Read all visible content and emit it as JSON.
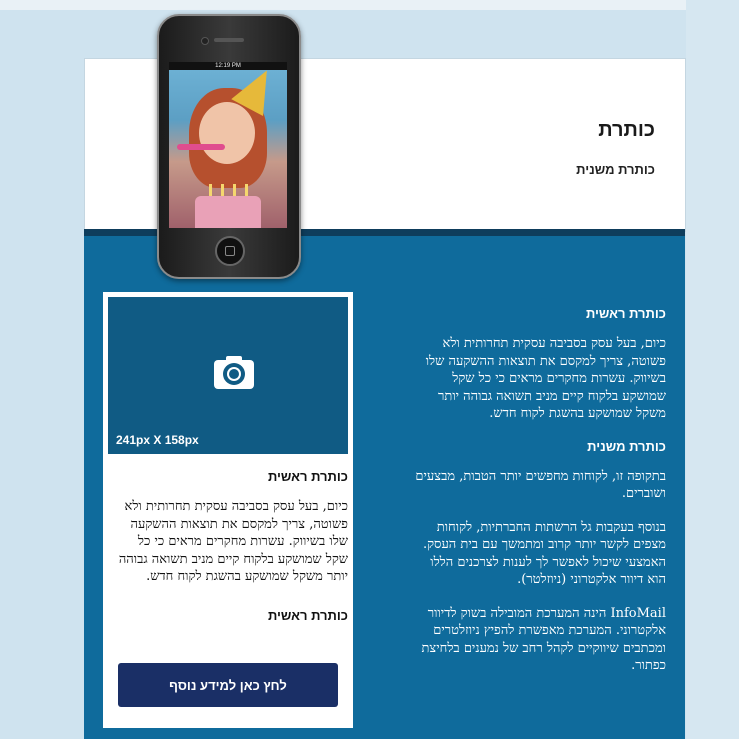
{
  "header": {
    "title": "כותרת",
    "subtitle": "כותרת משנית"
  },
  "phone": {
    "status_time": "12:19 PM"
  },
  "side_card": {
    "image_size_label": "241px X 158px",
    "heading": "כותרת ראשית",
    "text": "כיום, בעל עסק בסביבה עסקית תחרותית ולא פשוטה, צריך למקסם את תוצאות ההשקעה שלו בשיווק. עשרות מחקרים מראים כי כל שקל שמושקע בלקוח קיים מניב תשואה גבוהה יותר משקל שמושקע בהשגת לקוח חדש.",
    "heading2": "כותרת ראשית",
    "button_label": "לחץ כאן למידע נוסף"
  },
  "right_column": {
    "heading": "כותרת ראשית",
    "para1": "כיום, בעל עסק בסביבה עסקית תחרותית ולא פשוטה, צריך למקסם את תוצאות ההשקעה שלו בשיווק. עשרות מחקרים מראים כי כל שקל שמושקע בלקוח קיים מניב תשואה גבוהה יותר משקל שמושקע בהשגת לקוח חדש.",
    "subheading": "כותרת משנית",
    "para2": "בתקופה זו, לקוחות מחפשים יותר הטבות, מבצעים ושוברים.",
    "para3": "בנוסף בעקבות גל הרשתות החברתיות, לקוחות מצפים לקשר יותר קרוב ומתמשך עם בית העסק. האמצעי שיכול לאפשר לך לענות לצרכנים הללו הוא דיוור אלקטרוני (ניוזלטר).",
    "para4": "InfoMail הינה המערכת המובילה בשוק לדיוור אלקטרוני. המערכת מאפשרת להפיץ ניוזלטרים ומכתבים שיווקיים לקהל רחב של נמענים בלחיצת כפתור."
  },
  "colors": {
    "body_blue": "#0f6b9c",
    "image_blue": "#105b84",
    "button_navy": "#1a2f66",
    "header_strip": "#0e3d5c"
  },
  "icons": {
    "image_placeholder": "camera-icon"
  }
}
